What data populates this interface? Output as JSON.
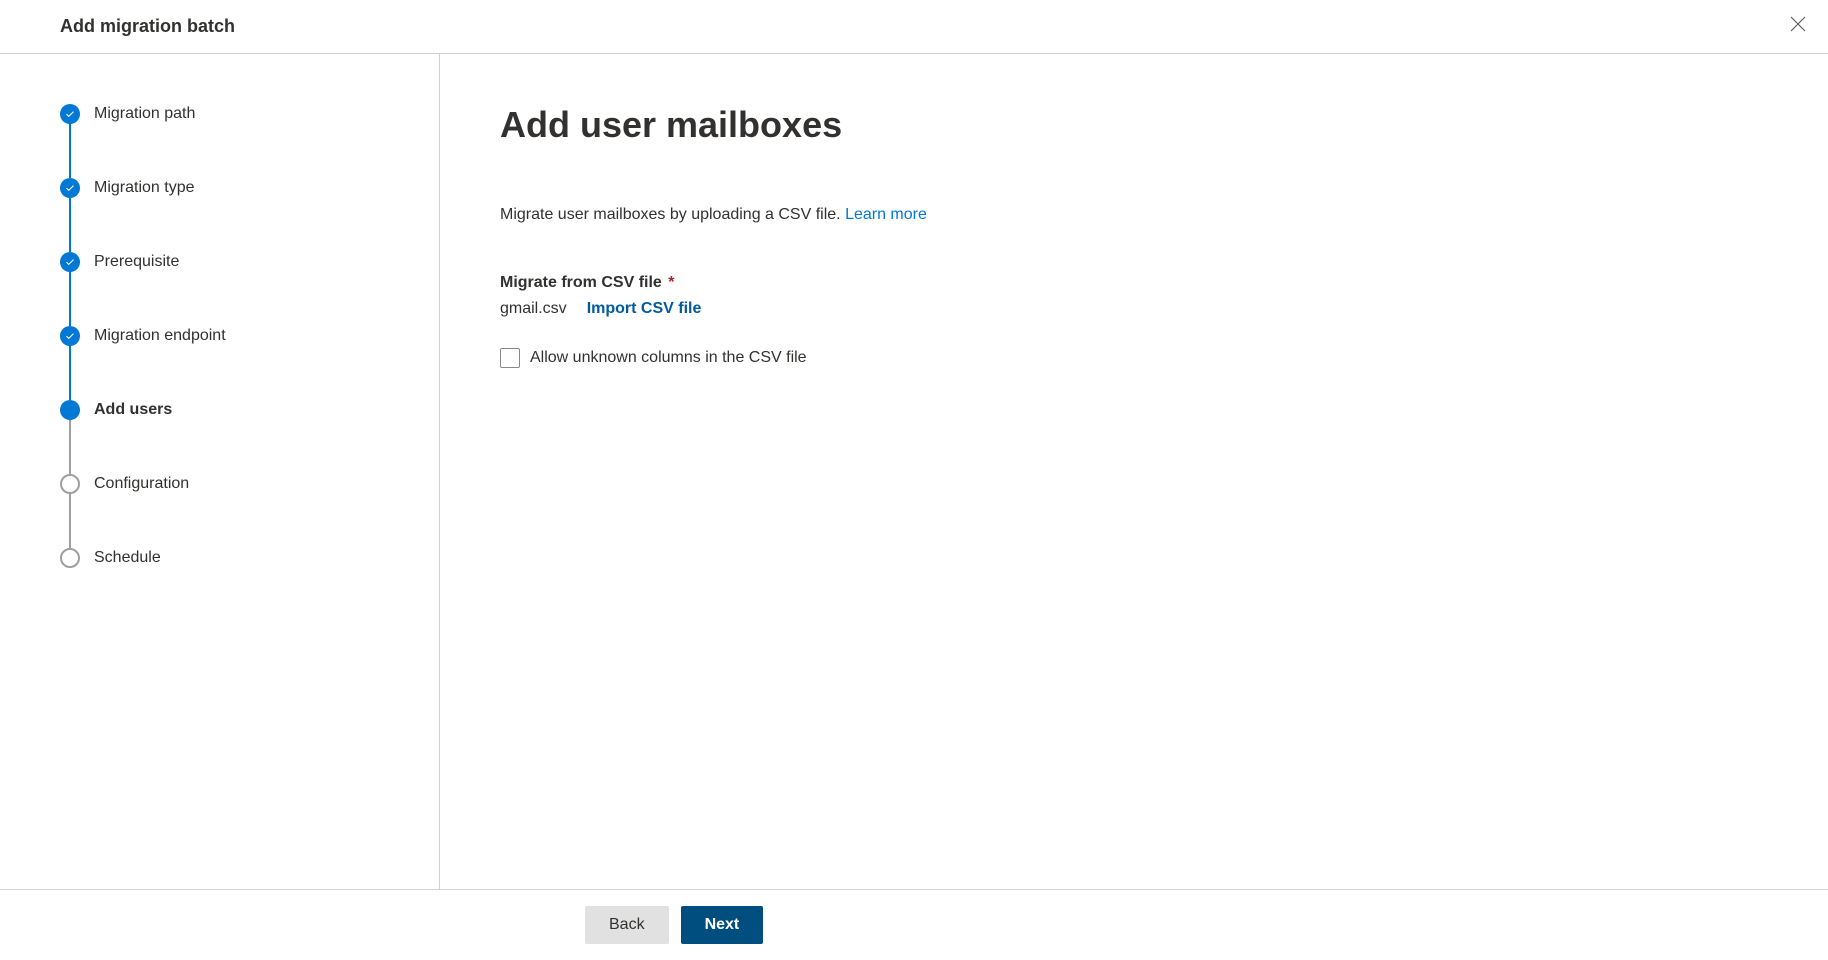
{
  "header": {
    "title": "Add migration batch"
  },
  "sidebar": {
    "steps": [
      {
        "label": "Migration path",
        "state": "completed"
      },
      {
        "label": "Migration type",
        "state": "completed"
      },
      {
        "label": "Prerequisite",
        "state": "completed"
      },
      {
        "label": "Migration endpoint",
        "state": "completed"
      },
      {
        "label": "Add users",
        "state": "current"
      },
      {
        "label": "Configuration",
        "state": "upcoming"
      },
      {
        "label": "Schedule",
        "state": "upcoming"
      }
    ]
  },
  "main": {
    "title": "Add user mailboxes",
    "description_text": "Migrate user mailboxes by uploading a CSV file. ",
    "learn_more_label": "Learn more",
    "csv_field_label": "Migrate from CSV file",
    "csv_file_name": "gmail.csv",
    "import_csv_label": "Import CSV file",
    "checkbox_label": "Allow unknown columns in the CSV file"
  },
  "footer": {
    "back_label": "Back",
    "next_label": "Next"
  }
}
